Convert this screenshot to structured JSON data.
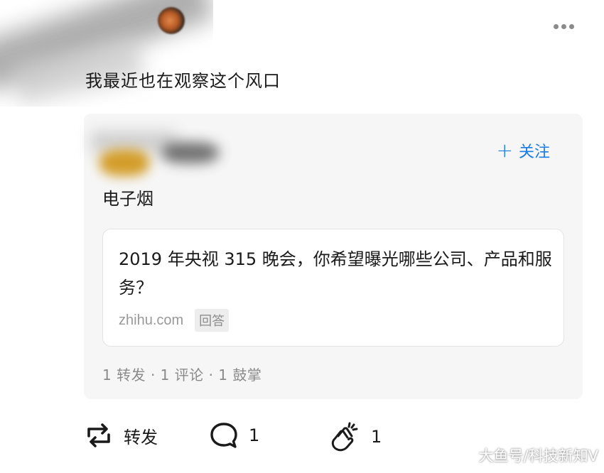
{
  "post": {
    "text": "我最近也在观察这个风口"
  },
  "shared_card": {
    "follow_label": "关注",
    "topic": "电子烟",
    "question": {
      "title": "2019 年央视 315 晚会，你希望曝光哪些公司、产品和服务？",
      "source": "zhihu.com",
      "tag": "回答"
    },
    "stats": "1 转发 · 1 评论 · 1 鼓掌"
  },
  "actions": {
    "repost_label": "转发",
    "comment_count": "1",
    "clap_count": "1"
  },
  "watermark": "大鱼号/科技新知V",
  "colors": {
    "accent": "#1a7ce8",
    "card_bg": "#f6f6f6",
    "muted_text": "#8a8a8a"
  },
  "icons": [
    "more-icon",
    "plus-icon",
    "repost-icon",
    "comment-icon",
    "clap-icon"
  ]
}
